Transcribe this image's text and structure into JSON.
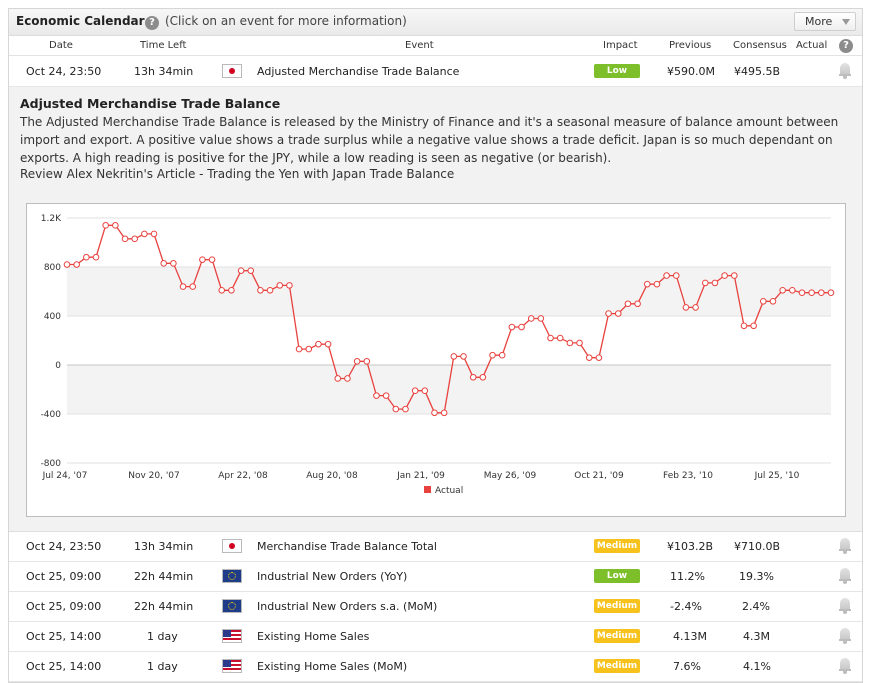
{
  "header": {
    "title": "Economic Calendar",
    "hint": "(Click on an event for more information)",
    "more_label": "More",
    "help_glyph": "?"
  },
  "columns": [
    "Date",
    "Time Left",
    "Event",
    "Impact",
    "Previous",
    "Consensus",
    "Actual"
  ],
  "rows": [
    {
      "date": "Oct 24, 23:50",
      "time_left": "13h 34min",
      "flag": "jp",
      "event": "Adjusted Merchandise Trade Balance",
      "impact": "Low",
      "previous": "¥590.0M",
      "consensus": "¥495.5B",
      "actual": ""
    },
    {
      "date": "Oct 24, 23:50",
      "time_left": "13h 34min",
      "flag": "jp",
      "event": "Merchandise Trade Balance Total",
      "impact": "Medium",
      "previous": "¥103.2B",
      "consensus": "¥710.0B",
      "actual": ""
    },
    {
      "date": "Oct 25, 09:00",
      "time_left": "22h 44min",
      "flag": "eu",
      "event": "Industrial New Orders (YoY)",
      "impact": "Low",
      "previous": "11.2%",
      "consensus": "19.3%",
      "actual": ""
    },
    {
      "date": "Oct 25, 09:00",
      "time_left": "22h 44min",
      "flag": "eu",
      "event": "Industrial New Orders s.a. (MoM)",
      "impact": "Medium",
      "previous": "-2.4%",
      "consensus": "2.4%",
      "actual": ""
    },
    {
      "date": "Oct 25, 14:00",
      "time_left": "1 day",
      "flag": "us",
      "event": "Existing Home Sales",
      "impact": "Medium",
      "previous": "4.13M",
      "consensus": "4.3M",
      "actual": ""
    },
    {
      "date": "Oct 25, 14:00",
      "time_left": "1 day",
      "flag": "us",
      "event": "Existing Home Sales (MoM)",
      "impact": "Medium",
      "previous": "7.6%",
      "consensus": "4.1%",
      "actual": ""
    }
  ],
  "details": {
    "title": "Adjusted Merchandise Trade Balance",
    "description": "The Adjusted Merchandise Trade Balance is released by the Ministry of Finance and it's a seasonal measure of balance amount between import and export. A positive value shows a trade surplus while a negative value shows a trade deficit. Japan is so much dependant on exports. A high reading is positive for the JPY, while a low reading is seen as negative (or bearish).",
    "article_link": "Review Alex Nekritin's Article - Trading the Yen with Japan Trade Balance"
  },
  "colors": {
    "series": "#e8423f",
    "low": "#7cbf2a",
    "medium": "#f6c21b"
  },
  "chart_data": {
    "type": "line",
    "title": "",
    "xlabel": "",
    "ylabel": "",
    "ylim": [
      -800,
      1200
    ],
    "y_ticks": [
      "1.2K",
      "800",
      "400",
      "0",
      "-400",
      "-800"
    ],
    "x_tick_labels": [
      "Jul 24, '07",
      "Nov 20, '07",
      "Apr 22, '08",
      "Aug 20, '08",
      "Jan 21, '09",
      "May 26, '09",
      "Oct 21, '09",
      "Feb 23, '10",
      "Jul 25, '10"
    ],
    "grid": true,
    "legend_position": "bottom",
    "series": [
      {
        "name": "Actual",
        "values": [
          820,
          820,
          880,
          880,
          1140,
          1140,
          1030,
          1030,
          1070,
          1070,
          830,
          830,
          640,
          640,
          860,
          860,
          610,
          610,
          770,
          770,
          610,
          610,
          650,
          650,
          130,
          130,
          170,
          170,
          -110,
          -110,
          30,
          30,
          -250,
          -250,
          -360,
          -360,
          -210,
          -210,
          -390,
          -390,
          70,
          70,
          -100,
          -100,
          80,
          80,
          310,
          310,
          380,
          380,
          220,
          220,
          180,
          180,
          60,
          60,
          420,
          420,
          500,
          500,
          660,
          660,
          730,
          730,
          470,
          470,
          670,
          670,
          730,
          730,
          320,
          320,
          520,
          520,
          610,
          610,
          590,
          590,
          590,
          590
        ]
      }
    ]
  }
}
